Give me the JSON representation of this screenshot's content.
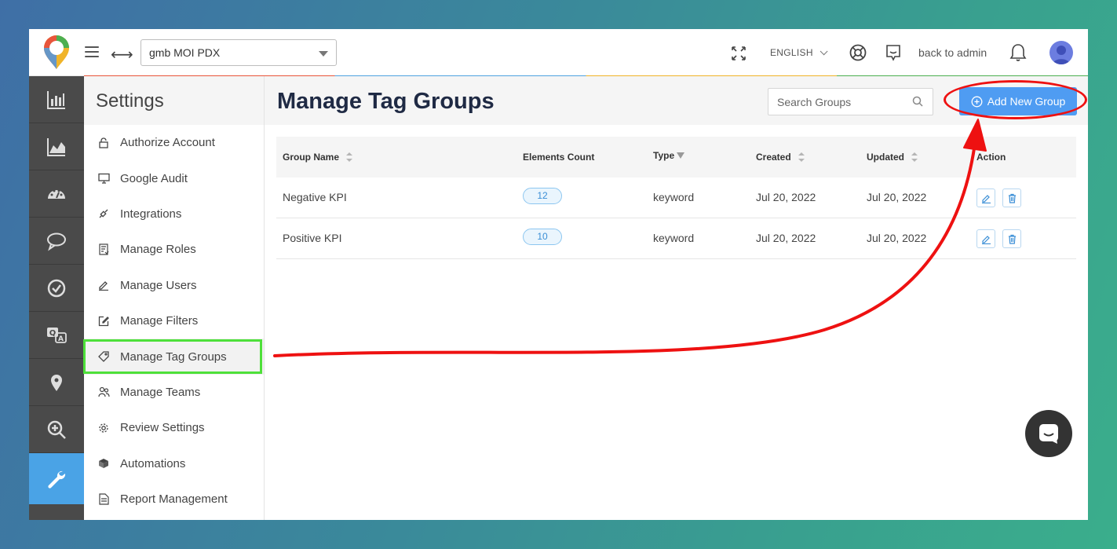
{
  "topbar": {
    "location": "gmb MOI PDX",
    "language": "ENGLISH",
    "back_to_admin": "back to admin"
  },
  "settings": {
    "title": "Settings",
    "items": [
      {
        "label": "Authorize Account",
        "icon": "lock-icon"
      },
      {
        "label": "Google Audit",
        "icon": "monitor-icon"
      },
      {
        "label": "Integrations",
        "icon": "plug-icon"
      },
      {
        "label": "Manage Roles",
        "icon": "roles-icon"
      },
      {
        "label": "Manage Users",
        "icon": "pencil-icon"
      },
      {
        "label": "Manage Filters",
        "icon": "edit-box-icon"
      },
      {
        "label": "Manage Tag Groups",
        "icon": "tag-icon"
      },
      {
        "label": "Manage Teams",
        "icon": "team-icon"
      },
      {
        "label": "Review Settings",
        "icon": "gear-icon"
      },
      {
        "label": "Automations",
        "icon": "cube-icon"
      },
      {
        "label": "Report Management",
        "icon": "report-icon"
      }
    ]
  },
  "main": {
    "title": "Manage Tag Groups",
    "search_placeholder": "Search Groups",
    "add_button": "Add New Group"
  },
  "table": {
    "columns": [
      "Group Name",
      "Elements Count",
      "Type",
      "Created",
      "Updated",
      "Action"
    ],
    "rows": [
      {
        "name": "Negative KPI",
        "count": "12",
        "type": "keyword",
        "created": "Jul 20, 2022",
        "updated": "Jul 20, 2022"
      },
      {
        "name": "Positive KPI",
        "count": "10",
        "type": "keyword",
        "created": "Jul 20, 2022",
        "updated": "Jul 20, 2022"
      }
    ]
  },
  "colors": {
    "accent_blue": "#4f9cf2",
    "rail_dark": "#4a4a4a",
    "rail_active": "#4aa3e6",
    "annotation_red": "#ee1111",
    "annotation_green": "#4ee03a"
  }
}
